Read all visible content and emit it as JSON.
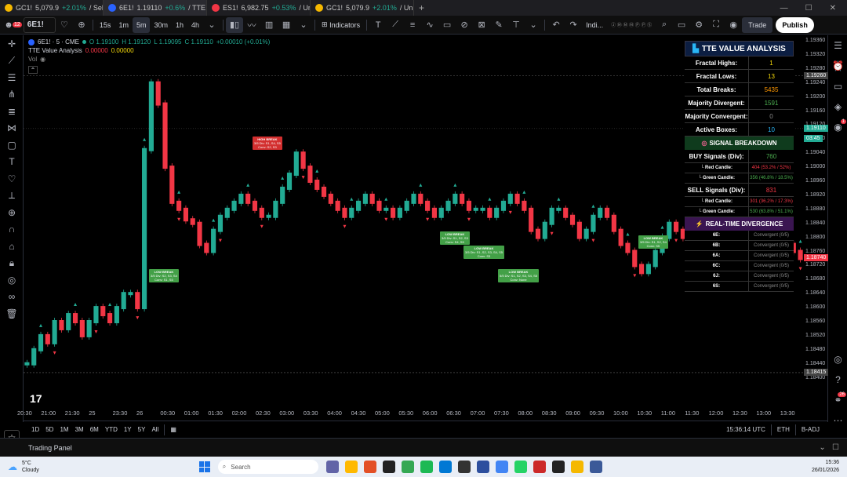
{
  "browser_tabs": [
    {
      "symbol": "GC1!",
      "price": "5,079.9",
      "change": "+2.01%",
      "suffix": "/ Sel",
      "icon_color": "#f5b800"
    },
    {
      "symbol": "6E1!",
      "price": "1.19110",
      "change": "+0.6%",
      "suffix": "/ TTE",
      "icon_color": "#2962ff"
    },
    {
      "symbol": "ES1!",
      "price": "6,982.75",
      "change": "+0.53%",
      "suffix": "/ Un",
      "icon_color": "#f23645"
    },
    {
      "symbol": "GC1!",
      "price": "5,079.9",
      "change": "+2.01%",
      "suffix": "/ Un",
      "icon_color": "#f5b800"
    }
  ],
  "toolbar": {
    "notif_count": "12",
    "symbol": "6E1!",
    "timeframes": [
      "15s",
      "1m",
      "5m",
      "30m",
      "1h",
      "4h"
    ],
    "active_timeframe": "5m",
    "indicators_label": "Indicators",
    "indi_label": "Indi...",
    "trade_label": "Trade",
    "publish_label": "Publish"
  },
  "legend": {
    "symbol_line": "6E1! · 5 · CME",
    "o": "O 1.19100",
    "h": "H 1.19120",
    "l": "L 1.19095",
    "c": "C 1.19110",
    "chg": "+0.00010 (+0.01%)",
    "indicator_name": "TTE Value Analysis",
    "ind_v1": "0.00000",
    "ind_v2": "0.00000",
    "vol_label": "Vol"
  },
  "price_axis": {
    "ticks": [
      "1.19360",
      "1.19320",
      "1.19280",
      "1.19240",
      "1.19200",
      "1.19160",
      "1.19120",
      "1.19080",
      "1.19040",
      "1.19000",
      "1.18960",
      "1.18920",
      "1.18880",
      "1.18840",
      "1.18800",
      "1.18760",
      "1.18720",
      "1.18680",
      "1.18640",
      "1.18600",
      "1.18560",
      "1.18520",
      "1.18480",
      "1.18440",
      "1.18400"
    ],
    "high_label": "High",
    "high_value": "1.19260",
    "current_value": "1.19110",
    "countdown": "03:45",
    "low_label": "Low",
    "low_value": "1.18415",
    "mark_value": "1.18740"
  },
  "time_axis": {
    "ticks": [
      "20:30",
      "21:00",
      "21:30",
      "25",
      "23:30",
      "26",
      "00:30",
      "01:00",
      "01:30",
      "02:00",
      "02:30",
      "03:00",
      "03:30",
      "04:00",
      "04:30",
      "05:00",
      "05:30",
      "06:00",
      "06:30",
      "07:00",
      "07:30",
      "08:00",
      "08:30",
      "09:00",
      "09:30",
      "10:00",
      "10:30",
      "11:00",
      "11:30",
      "12:00",
      "12:30",
      "13:00",
      "13:30"
    ]
  },
  "analysis_table": {
    "title": "TTE VALUE ANALYSIS",
    "rows": [
      {
        "label": "Fractal Highs:",
        "value": "1",
        "color": "#f5d90a"
      },
      {
        "label": "Fractal Lows:",
        "value": "13",
        "color": "#f5d90a"
      },
      {
        "label": "Total Breaks:",
        "value": "5435",
        "color": "#ff9800"
      },
      {
        "label": "Majority Divergent:",
        "value": "1591",
        "color": "#4caf50"
      },
      {
        "label": "Majority Convergent:",
        "value": "0",
        "color": "#888888"
      },
      {
        "label": "Active Boxes:",
        "value": "10",
        "color": "#29b6f6"
      }
    ],
    "signal_header": "SIGNAL BREAKDOWN",
    "buy_label": "BUY Signals (Div):",
    "buy_value": "760",
    "buy_red_label": "└ Red Candle:",
    "buy_red_value": "404 (53.2% / 52%)",
    "buy_green_label": "└ Green Candle:",
    "buy_green_value": "356 (46.8% / 18.5%)",
    "sell_label": "SELL Signals (Div):",
    "sell_value": "831",
    "sell_red_label": "└ Red Candle:",
    "sell_red_value": "301 (36.2% / 17.3%)",
    "sell_green_label": "└ Green Candle:",
    "sell_green_value": "530 (63.8% / 51.1%)",
    "div_header": "REAL-TIME DIVERGENCE",
    "div_rows": [
      {
        "tf": "6E:",
        "status": "Convergent (0/5)"
      },
      {
        "tf": "6B:",
        "status": "Convergent (0/5)"
      },
      {
        "tf": "6A:",
        "status": "Convergent (0/5)"
      },
      {
        "tf": "6C:",
        "status": "Convergent (0/5)"
      },
      {
        "tf": "6J:",
        "status": "Convergent (0/5)"
      },
      {
        "tf": "6S:",
        "status": "Convergent (0/5)"
      }
    ]
  },
  "chart_labels": [
    {
      "title": "HIGH BREAK",
      "line1": "3/5 Div: S1, S4, S5",
      "line2": "Conv: S2, S3",
      "kind": "high"
    },
    {
      "title": "LOW BREAK",
      "line1": "3/5 Div: S2, S3, S4",
      "line2": "Conv: S1, S5",
      "kind": "low"
    },
    {
      "title": "LOW BREAK",
      "line1": "3/5 Div: S1, S2, S3",
      "line2": "Conv: S4, S5",
      "kind": "low"
    },
    {
      "title": "LOW BREAK",
      "line1": "3/5 Div: S1, S2, S3, S4, S5",
      "line2": "Conv: S3",
      "kind": "low"
    },
    {
      "title": "LOW BREAK",
      "line1": "5/5 Div: S1, S2, S3, S4, S5",
      "line2": "Conv: None",
      "kind": "low"
    },
    {
      "title": "LOW BREAK",
      "line1": "3/5 Div: S1, S2, S4",
      "line2": "Conv: S5",
      "kind": "low"
    }
  ],
  "bottom_bar": {
    "ranges": [
      "1D",
      "5D",
      "1M",
      "3M",
      "6M",
      "YTD",
      "1Y",
      "5Y",
      "All"
    ],
    "time": "15:36:14 UTC",
    "exchange": "ETH",
    "adj": "B-ADJ"
  },
  "trading_panel": {
    "label": "Trading Panel"
  },
  "taskbar": {
    "weather_temp": "5°C",
    "weather_desc": "Cloudy",
    "search_placeholder": "Search",
    "clock_time": "15:36",
    "clock_date": "26/01/2026"
  },
  "colors": {
    "up": "#22ab94",
    "down": "#f23645",
    "label_high": "#d32f2f",
    "label_low": "#43a047"
  }
}
